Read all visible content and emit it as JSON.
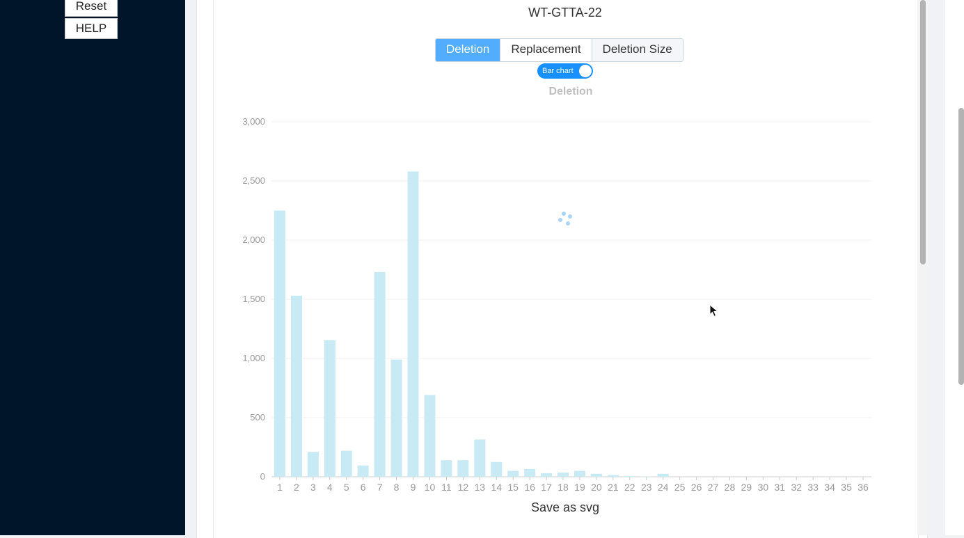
{
  "sidebar": {
    "reset_label": "Reset",
    "help_label": "HELP"
  },
  "sample_title": "WT-GTTA-22",
  "tabs": [
    {
      "label": "Deletion",
      "active": true
    },
    {
      "label": "Replacement",
      "active": false
    },
    {
      "label": "Deletion Size",
      "active": false
    }
  ],
  "toggle": {
    "label": "Bar chart",
    "on": true
  },
  "save_label": "Save as svg",
  "loading_spinner": "spinner-icon",
  "colors": {
    "sidebar": "#001529",
    "tab_active": "#52adff",
    "toggle": "#1890ff",
    "bar": "#c8eaf4",
    "axis_text": "#999999",
    "title_text": "#bfbfbf"
  },
  "chart_data": {
    "type": "bar",
    "title": "Deletion",
    "categories": [
      "1",
      "2",
      "3",
      "4",
      "5",
      "6",
      "7",
      "8",
      "9",
      "10",
      "11",
      "12",
      "13",
      "14",
      "15",
      "16",
      "17",
      "18",
      "19",
      "20",
      "21",
      "22",
      "23",
      "24",
      "25",
      "26",
      "27",
      "28",
      "29",
      "30",
      "31",
      "32",
      "33",
      "34",
      "35",
      "36"
    ],
    "values": [
      2250,
      1530,
      210,
      1155,
      220,
      95,
      1730,
      990,
      2580,
      690,
      140,
      140,
      315,
      125,
      50,
      65,
      30,
      35,
      50,
      25,
      15,
      5,
      3,
      25,
      0,
      0,
      0,
      0,
      0,
      0,
      0,
      0,
      0,
      0,
      0,
      0
    ],
    "yticks": [
      "0",
      "500",
      "1,000",
      "1,500",
      "2,000",
      "2,500",
      "3,000"
    ],
    "ylim": [
      0,
      3000
    ],
    "grid": true,
    "xlabel": "",
    "ylabel": ""
  }
}
